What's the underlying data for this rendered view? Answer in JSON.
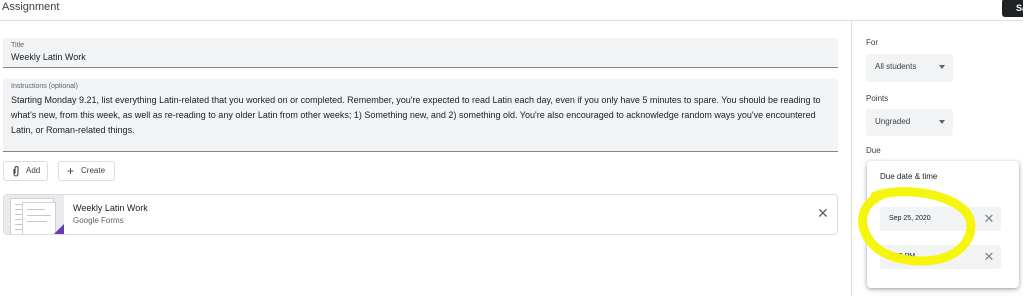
{
  "header": {
    "title": "Assignment",
    "save_label": "Sa"
  },
  "title_field": {
    "label": "Title",
    "value": "Weekly Latin Work"
  },
  "instructions_field": {
    "label": "Instructions (optional)",
    "value": "Starting Monday 9.21, list everything Latin-related that you worked on or completed. Remember, you're expected to read Latin each day, even if you only have 5 minutes to spare. You should be reading to what's new, from this week, as well as re-reading to any older Latin from other weeks; 1) Something new, and 2) something old. You're also encouraged to acknowledge random ways you've encountered Latin, or Roman-related things."
  },
  "actions": {
    "add_label": "Add",
    "create_label": "Create",
    "add_icon": "paperclip-icon",
    "create_icon": "plus-icon"
  },
  "attachment": {
    "title": "Weekly Latin Work",
    "subtitle": "Google Forms",
    "remove_icon": "close-icon"
  },
  "sidebar": {
    "for_label": "For",
    "for_value": "All students",
    "points_label": "Points",
    "points_value": "Ungraded",
    "due_label": "Due"
  },
  "due_popup": {
    "title": "Due date & time",
    "date": "Sep 25, 2020",
    "time": "3:00 PM",
    "clear_icon": "close-icon"
  },
  "colors": {
    "field_bg": "#f1f3f4",
    "highlight": "#f4f400",
    "form_corner": "#673ab7"
  }
}
